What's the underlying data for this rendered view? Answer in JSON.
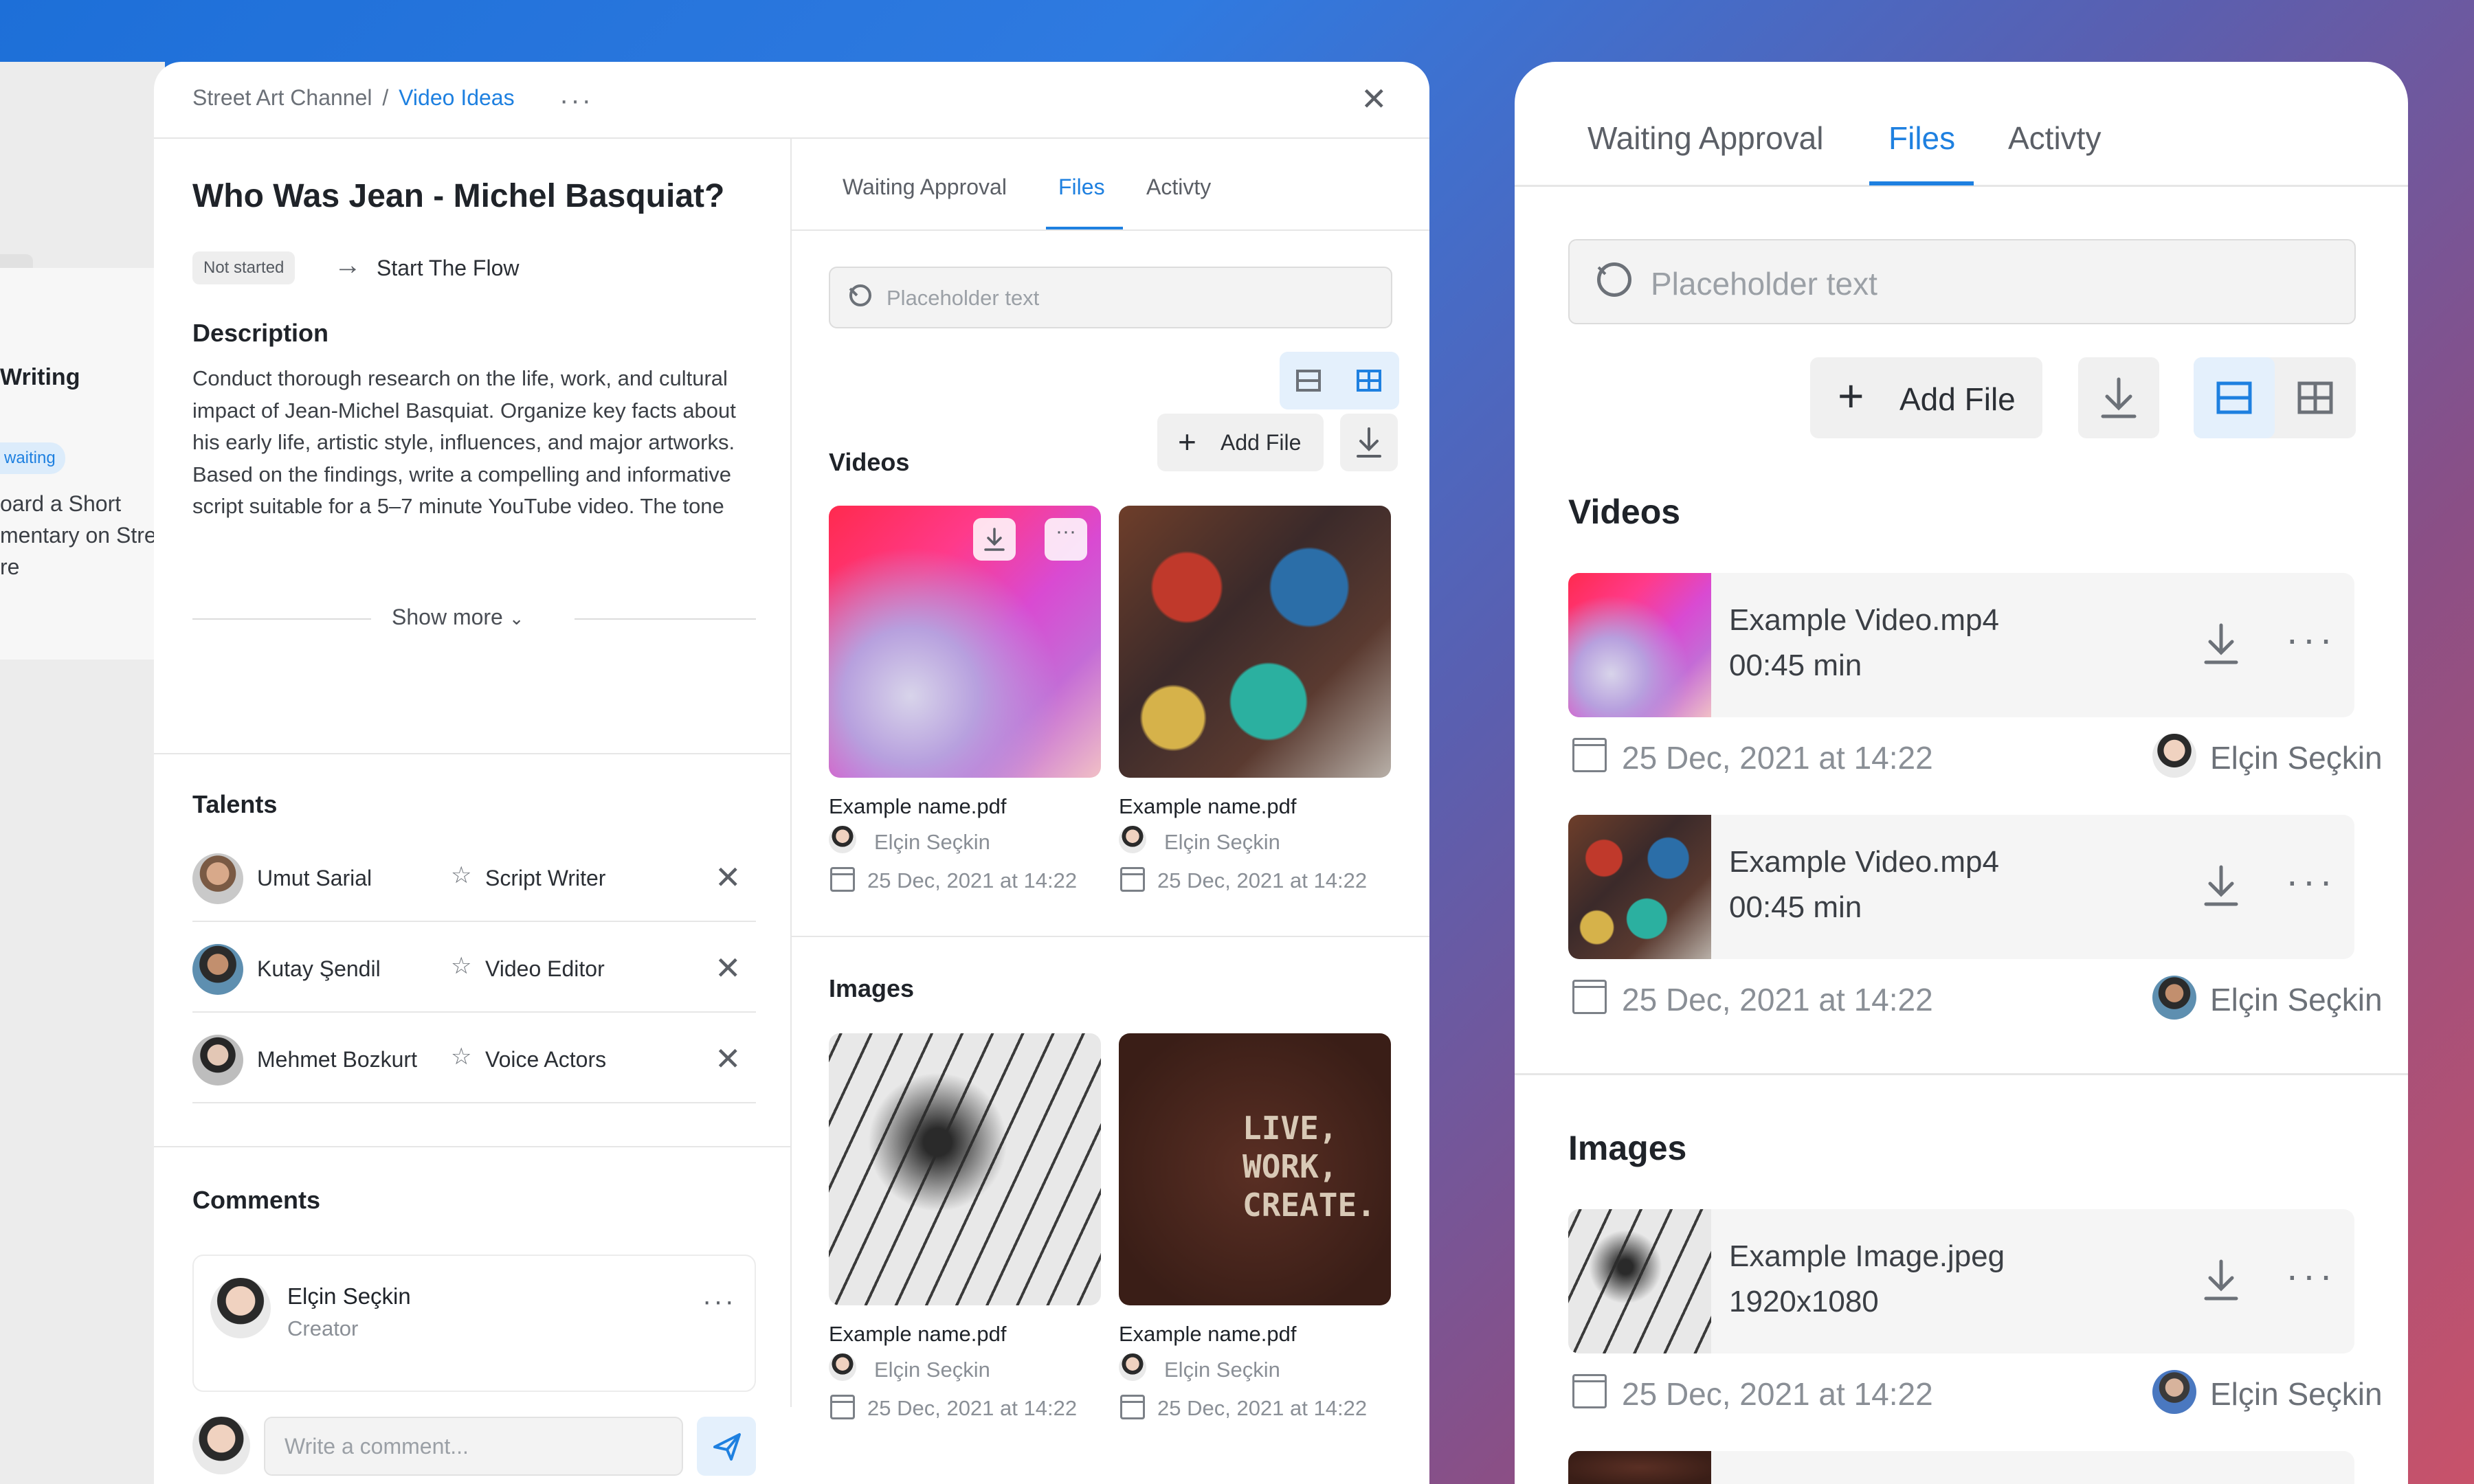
{
  "background_fragment": {
    "title": "Writing",
    "badge": "waiting",
    "text_lines": [
      "oard a Short",
      "mentary on Stre",
      "re"
    ]
  },
  "task": {
    "breadcrumb_channel": "Street Art Channel",
    "breadcrumb_sep": "/",
    "breadcrumb_current": "Video Ideas",
    "title": "Who Was Jean - Michel Basquiat?",
    "status": "Not started",
    "flow_label": "Start The Flow",
    "description_label": "Description",
    "description": "Conduct thorough research on the life, work, and cultural impact of Jean-Michel Basquiat. Organize key facts about his early life, artistic style, influences, and major artworks. Based on the findings, write a compelling and informative script suitable for a 5–7 minute YouTube video. The tone should be engaging and accessible, aimed at a general audience with an interest in modern art, street culture, and cultural history. Ensure the script includes a strong introducti…",
    "show_more": "Show more"
  },
  "talents": {
    "heading": "Talents",
    "items": [
      {
        "name": "Umut Sarial",
        "role": "Script Writer"
      },
      {
        "name": "Kutay Şendil",
        "role": "Video Editor"
      },
      {
        "name": "Mehmet Bozkurt",
        "role": "Voice Actors"
      }
    ]
  },
  "comments": {
    "heading": "Comments",
    "first": {
      "author": "Elçin Seçkin",
      "role": "Creator"
    },
    "input_placeholder": "Write a comment..."
  },
  "files_panel": {
    "tabs": [
      "Waiting Approval",
      "Files",
      "Activty"
    ],
    "active_tab": "Files",
    "search_placeholder": "Placeholder text",
    "add_file_label": "Add File",
    "videos_heading": "Videos",
    "images_heading": "Images",
    "videos": [
      {
        "name": "Example name.pdf",
        "author": "Elçin Seçkin",
        "date": "25 Dec, 2021 at 14:22"
      },
      {
        "name": "Example name.pdf",
        "author": "Elçin Seçkin",
        "date": "25 Dec, 2021 at 14:22"
      }
    ],
    "images": [
      {
        "name": "Example name.pdf",
        "author": "Elçin Seçkin",
        "date": "25 Dec, 2021 at 14:22"
      },
      {
        "name": "Example name.pdf",
        "author": "Elçin Seçkin",
        "date": "25 Dec, 2021 at 14:22"
      }
    ],
    "wall_text": "LIVE,\nWORK,\nCREATE."
  },
  "files_list_panel": {
    "tabs": [
      "Waiting Approval",
      "Files",
      "Activty"
    ],
    "active_tab": "Files",
    "search_placeholder": "Placeholder text",
    "add_file_label": "Add File",
    "videos_heading": "Videos",
    "images_heading": "Images",
    "videos": [
      {
        "name": "Example Video.mp4",
        "detail": "00:45 min",
        "date": "25 Dec, 2021 at 14:22",
        "author": "Elçin Seçkin"
      },
      {
        "name": "Example Video.mp4",
        "detail": "00:45 min",
        "date": "25 Dec, 2021 at 14:22",
        "author": "Elçin Seçkin"
      }
    ],
    "images": [
      {
        "name": "Example Image.jpeg",
        "detail": "1920x1080",
        "date": "25 Dec, 2021 at 14:22",
        "author": "Elçin Seçkin"
      }
    ]
  },
  "colors": {
    "accent": "#1e80e0",
    "badge_bg": "#eeeeee",
    "active_tab": "#1e80e0"
  },
  "icons": [
    "close-icon",
    "more-icon",
    "arrow-right-icon",
    "chevron-down-icon",
    "badge-icon",
    "search-icon",
    "plus-icon",
    "download-icon",
    "list-view-icon",
    "grid-view-icon",
    "calendar-icon",
    "send-icon"
  ]
}
